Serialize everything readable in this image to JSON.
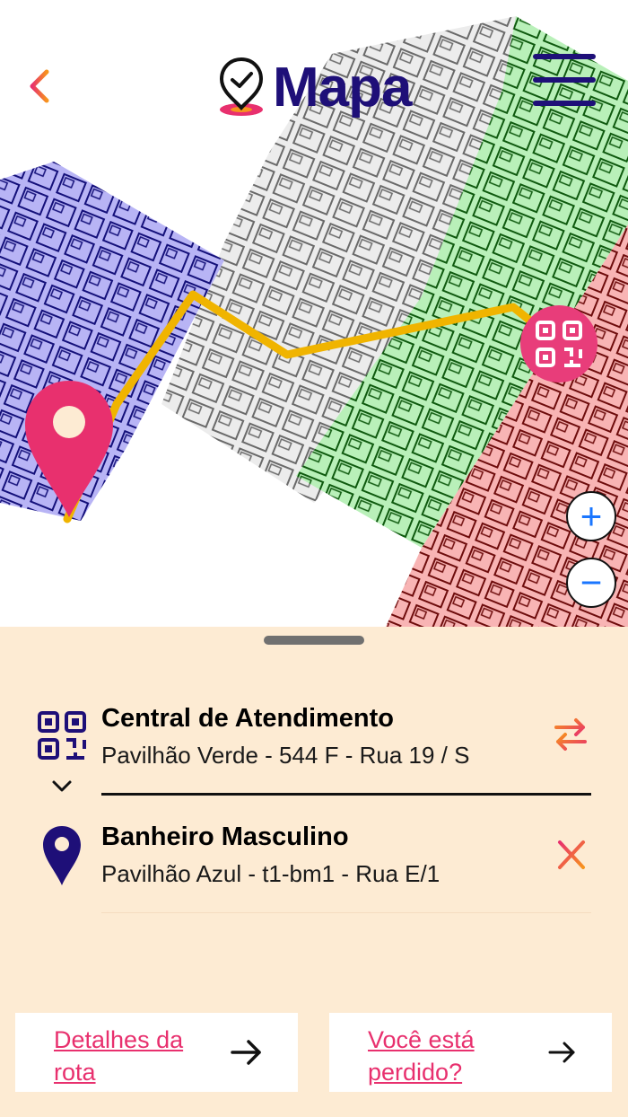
{
  "header": {
    "title": "Mapa",
    "back_icon": "arrow-left-icon",
    "title_icon": "location-check-icon",
    "menu_icon": "hamburger-menu-icon"
  },
  "map": {
    "zones": [
      {
        "name": "Pavilhão Azul",
        "color": "#3a2ad6"
      },
      {
        "name": "Pavilhão Cinza",
        "color": "#8a8a8a"
      },
      {
        "name": "Pavilhão Verde",
        "color": "#1ea01e"
      },
      {
        "name": "Pavilhão Vermelho",
        "color": "#b01818"
      }
    ],
    "route_color": "#f0b400",
    "origin_marker_icon": "qr-code-icon",
    "destination_marker_icon": "map-pin-icon",
    "zoom_in_label": "+",
    "zoom_out_label": "−"
  },
  "route": {
    "origin": {
      "name": "Central de Atendimento",
      "detail": "Pavilhão Verde - 544 F - Rua 19 / S",
      "icon": "qr-code-icon",
      "action_icon": "swap-icon"
    },
    "destination": {
      "name": "Banheiro Masculino",
      "detail": "Pavilhão Azul - t1-bm1 - Rua E/1",
      "icon": "map-pin-icon",
      "action_icon": "close-icon"
    }
  },
  "buttons": {
    "route_details": "Detalhes da rota",
    "lost": "Você está perdido?"
  },
  "colors": {
    "brand_primary": "#1e0f78",
    "accent_pink": "#e8306e",
    "accent_orange": "#f7941d",
    "sheet_background": "#fdebd3"
  }
}
